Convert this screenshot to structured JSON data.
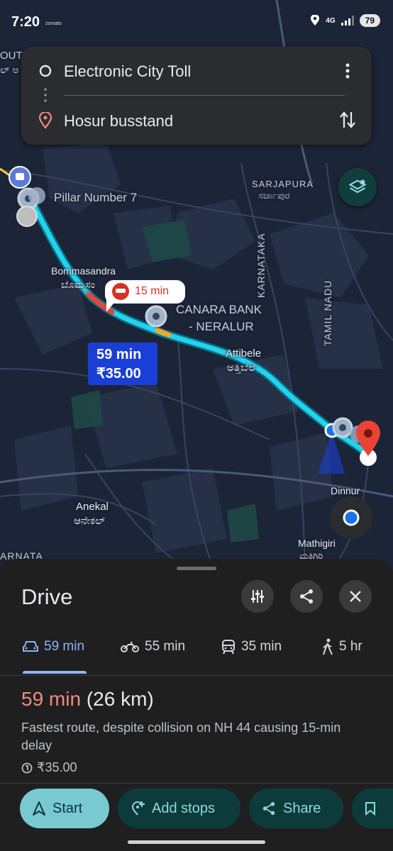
{
  "status_bar": {
    "time": "7:20",
    "app_hint": "zomato",
    "network": "4G",
    "battery": "79"
  },
  "search": {
    "origin": "Electronic City Toll",
    "destination": "Hosur busstand"
  },
  "map_labels": {
    "pillar": "Pillar Number 7",
    "sarjapura": "SARJAPURA",
    "sarjapura_kn": "ಸರ್ಜಾಪುರ",
    "bommasandra": "Bommasandra",
    "bommasandra_kn": "ಬೊಮ್ಮಸಂ",
    "canara1": "CANARA BANK",
    "canara2": "- NERALUR",
    "karnataka": "KARNATAKA",
    "tamil_nadu": "TAMIL NADU",
    "attibele": "Attibele",
    "attibele_kn": "ಅತ್ತಿಬೆಲೆ",
    "anekal": "Anekal",
    "anekal_kn": "ಆನೇಕಲ್",
    "dinnur": "Dinnur",
    "mathigiri": "Mathigiri",
    "mathigiri_kn": "ಮತಿಗಿರಿ",
    "edge_left": "OUT",
    "edge_left2": "ಲ್ ಅ",
    "edge_bottom": "ARNATA"
  },
  "incident": {
    "delay": "15 min"
  },
  "route_callout": {
    "time": "59 min",
    "toll": "₹35.00"
  },
  "sheet": {
    "title": "Drive",
    "modes": [
      {
        "icon": "car-icon",
        "label": "59 min"
      },
      {
        "icon": "motorbike-icon",
        "label": "55 min"
      },
      {
        "icon": "transit-icon",
        "label": "35 min"
      },
      {
        "icon": "walk-icon",
        "label": "5 hr"
      }
    ],
    "summary_time": "59 min",
    "summary_distance": "(26 km)",
    "description": "Fastest route, despite collision on NH 44 causing 15-min delay",
    "toll": "₹35.00",
    "actions": {
      "start": "Start",
      "add_stops": "Add stops",
      "share": "Share"
    }
  },
  "colors": {
    "route": "#21d3ee",
    "accent": "#8ab4f8",
    "delay": "#f28b82",
    "callout": "#1a3fd6"
  }
}
